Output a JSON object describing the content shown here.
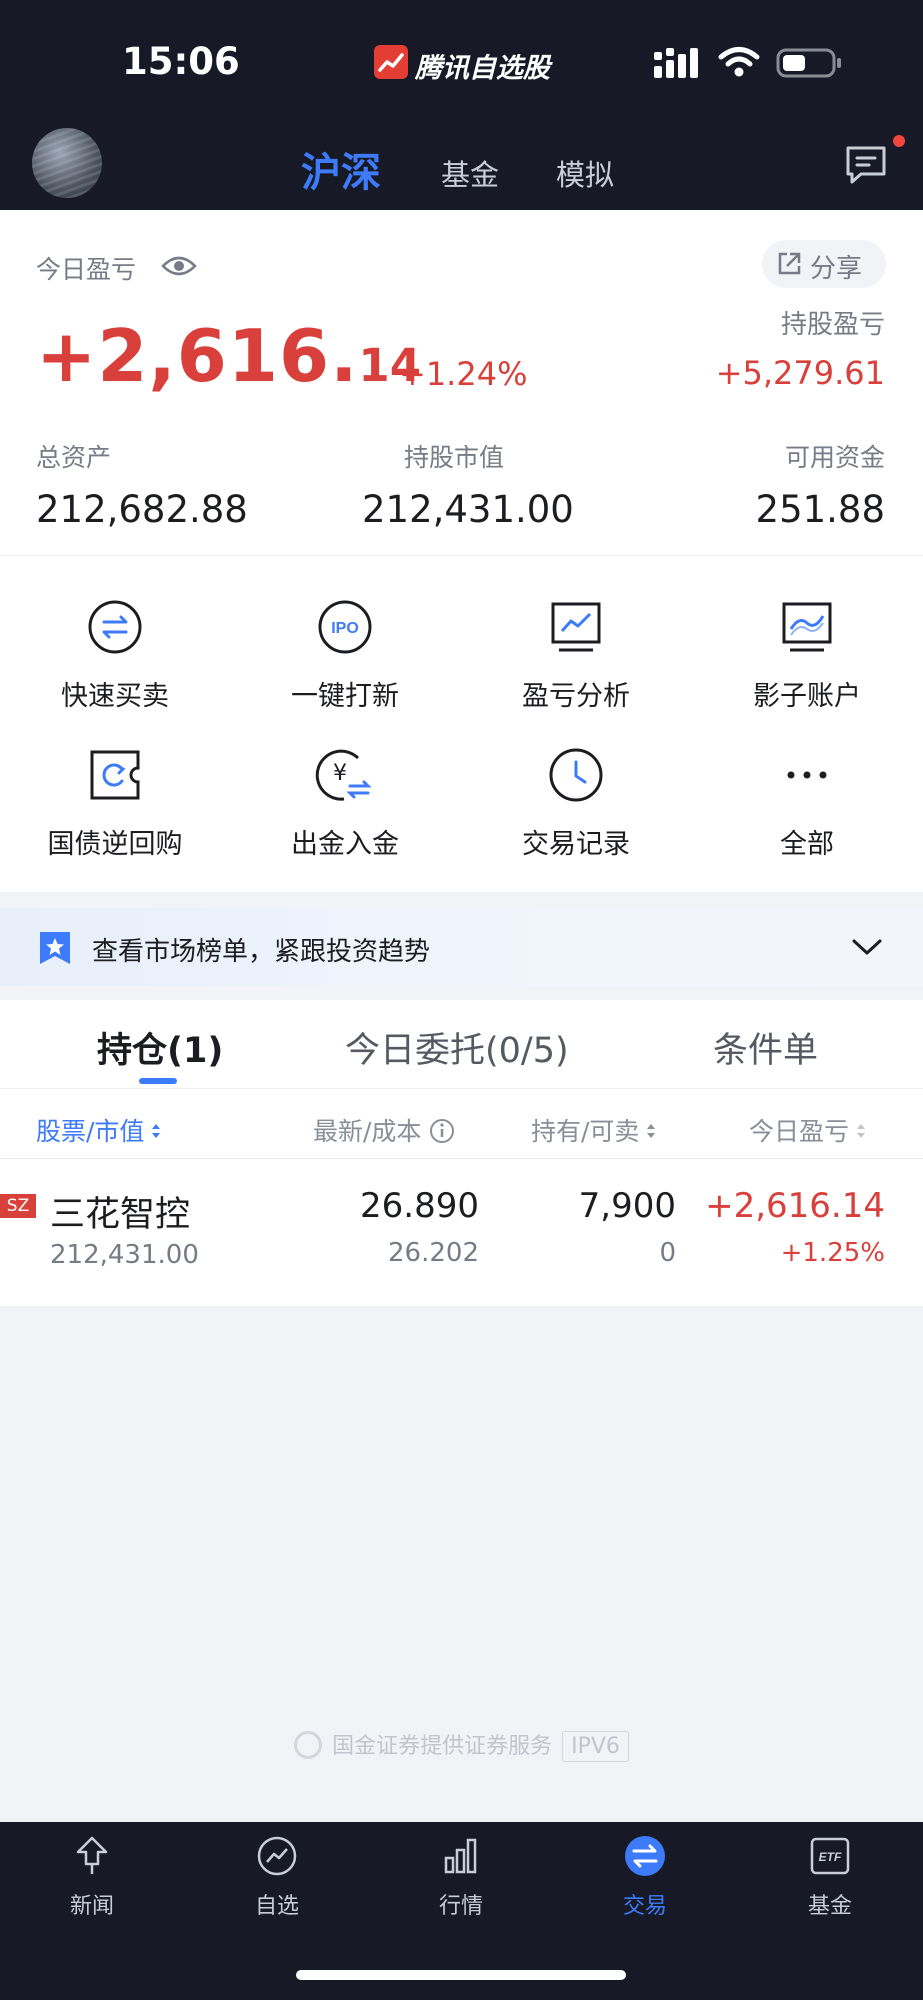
{
  "status_bar": {
    "time": "15:06",
    "app_name": "腾讯自选股"
  },
  "header": {
    "tabs": [
      {
        "label": "沪深",
        "active": true
      },
      {
        "label": "基金",
        "active": false
      },
      {
        "label": "模拟",
        "active": false
      }
    ]
  },
  "summary": {
    "today_label": "今日盈亏",
    "share_label": "分享",
    "today_pnl_int": "+2,616.",
    "today_pnl_dec": "14",
    "today_pnl_pct": "+1.24%",
    "holding_pnl_label": "持股盈亏",
    "holding_pnl_value": "+5,279.61",
    "total_assets_label": "总资产",
    "total_assets_value": "212,682.88",
    "market_value_label": "持股市值",
    "market_value_value": "212,431.00",
    "available_label": "可用资金",
    "available_value": "251.88"
  },
  "quick_actions": [
    {
      "label": "快速买卖",
      "icon": "swap-icon"
    },
    {
      "label": "一键打新",
      "icon": "ipo-icon"
    },
    {
      "label": "盈亏分析",
      "icon": "chart-monitor-icon"
    },
    {
      "label": "影子账户",
      "icon": "shadow-account-icon"
    },
    {
      "label": "国债逆回购",
      "icon": "repo-icon"
    },
    {
      "label": "出金入金",
      "icon": "yuan-transfer-icon"
    },
    {
      "label": "交易记录",
      "icon": "clock-icon"
    },
    {
      "label": "全部",
      "icon": "more-icon"
    }
  ],
  "banner": {
    "text": "查看市场榜单，紧跟投资趋势"
  },
  "positions": {
    "tabs": [
      {
        "label": "持仓(1)",
        "active": true
      },
      {
        "label": "今日委托(0/5)",
        "active": false
      },
      {
        "label": "条件单",
        "active": false
      }
    ],
    "headers": [
      "股票/市值",
      "最新/成本",
      "持有/可卖",
      "今日盈亏"
    ],
    "rows": [
      {
        "market": "SZ",
        "name": "三花智控",
        "market_value": "212,431.00",
        "latest": "26.890",
        "cost": "26.202",
        "holding": "7,900",
        "sellable": "0",
        "today_pnl": "+2,616.14",
        "today_pct": "+1.25%"
      }
    ]
  },
  "footer": {
    "provider": "国金证券提供证券服务",
    "ip": "IPV6"
  },
  "bottom_nav": [
    {
      "label": "新闻",
      "active": false
    },
    {
      "label": "自选",
      "active": false
    },
    {
      "label": "行情",
      "active": false
    },
    {
      "label": "交易",
      "active": true
    },
    {
      "label": "基金",
      "active": false
    }
  ],
  "colors": {
    "accent": "#3d7bfa",
    "gain": "#d9403b",
    "header_bg": "#171a26"
  }
}
